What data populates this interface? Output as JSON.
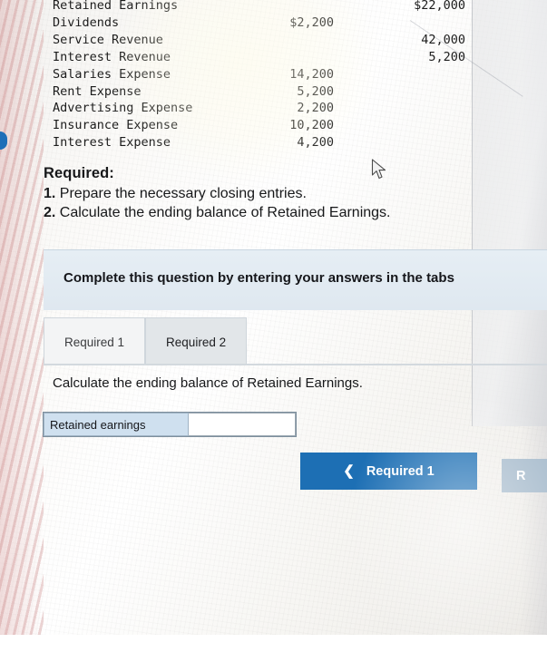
{
  "trial_balance": {
    "rows": [
      {
        "account": "Retained Earnings",
        "col1": "",
        "col2": "$22,000"
      },
      {
        "account": "Dividends",
        "col1": "$2,200",
        "col2": ""
      },
      {
        "account": "Service Revenue",
        "col1": "",
        "col2": "42,000"
      },
      {
        "account": "Interest Revenue",
        "col1": "",
        "col2": "5,200"
      },
      {
        "account": "Salaries Expense",
        "col1": "14,200",
        "col2": ""
      },
      {
        "account": "Rent Expense",
        "col1": "5,200",
        "col2": ""
      },
      {
        "account": "Advertising Expense",
        "col1": "2,200",
        "col2": ""
      },
      {
        "account": "Insurance Expense",
        "col1": "10,200",
        "col2": ""
      },
      {
        "account": "Interest Expense",
        "col1": "4,200",
        "col2": ""
      }
    ]
  },
  "required": {
    "title": "Required:",
    "items": [
      {
        "number": "1.",
        "text": "Prepare the necessary closing entries."
      },
      {
        "number": "2.",
        "text": "Calculate the ending balance of Retained Earnings."
      }
    ]
  },
  "question_panel": {
    "instruction": "Complete this question by entering your answers in the tabs"
  },
  "tabs": [
    {
      "label": "Required 1",
      "active": false
    },
    {
      "label": "Required 2",
      "active": true
    }
  ],
  "prompt": "Calculate the ending balance of Retained Earnings.",
  "answer": {
    "label": "Retained earnings",
    "value": "",
    "placeholder": ""
  },
  "navigation": {
    "prev_label": "Required 1",
    "prev_icon": "chevron-left-icon",
    "next_label": "R",
    "next_icon": "chevron-right-icon"
  },
  "colors": {
    "accent_blue": "#1d6fb4",
    "tab_active_bg": "#e2e6e9",
    "panel_bg": "#e3ebf2",
    "answer_label_bg": "#cfe0ef",
    "next_disabled": "#a8bccd"
  },
  "cursor": {
    "icon": "mouse-pointer-icon"
  }
}
